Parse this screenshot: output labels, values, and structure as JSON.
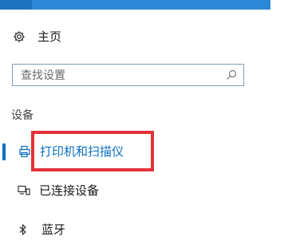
{
  "sidebar": {
    "home": {
      "label": "主页",
      "icon": "gear-icon"
    },
    "search": {
      "placeholder": "查找设置",
      "icon": "search-icon"
    },
    "section_title": "设备",
    "items": [
      {
        "label": "打印机和扫描仪",
        "icon": "printer-icon",
        "selected": true
      },
      {
        "label": "已连接设备",
        "icon": "connected-devices-icon",
        "selected": false
      },
      {
        "label": "蓝牙",
        "icon": "bluetooth-icon",
        "selected": false
      }
    ]
  },
  "colors": {
    "accent": "#0a6fc2",
    "titlebar": "#2b88d8",
    "highlight": "#e33039"
  }
}
